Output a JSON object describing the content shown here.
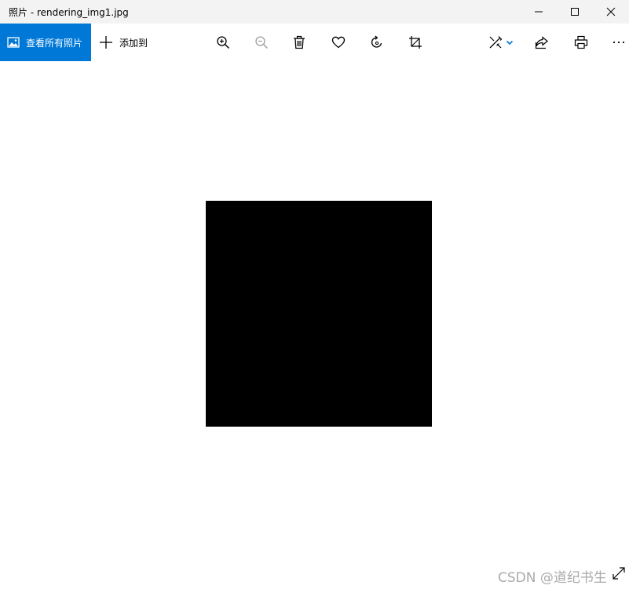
{
  "window": {
    "title": "照片 - rendering_img1.jpg"
  },
  "toolbar": {
    "view_all_label": "查看所有照片",
    "add_to_label": "添加到"
  },
  "watermark": {
    "text": "CSDN @道纪书生"
  },
  "colors": {
    "accent": "#0078d7",
    "titlebar_bg": "#f3f3f3",
    "photo": "#000000",
    "disabled_icon": "#a0a0a0"
  },
  "icons": {
    "view_all": "photo-gallery-icon",
    "add": "plus-icon",
    "zoom_in": "zoom-in-icon",
    "zoom_out": "zoom-out-icon",
    "delete": "trash-icon",
    "favorite": "heart-icon",
    "rotate": "rotate-icon",
    "crop": "crop-icon",
    "edit": "edit-create-icon",
    "share": "share-icon",
    "print": "print-icon",
    "more": "more-icon",
    "fullscreen": "expand-icon"
  }
}
